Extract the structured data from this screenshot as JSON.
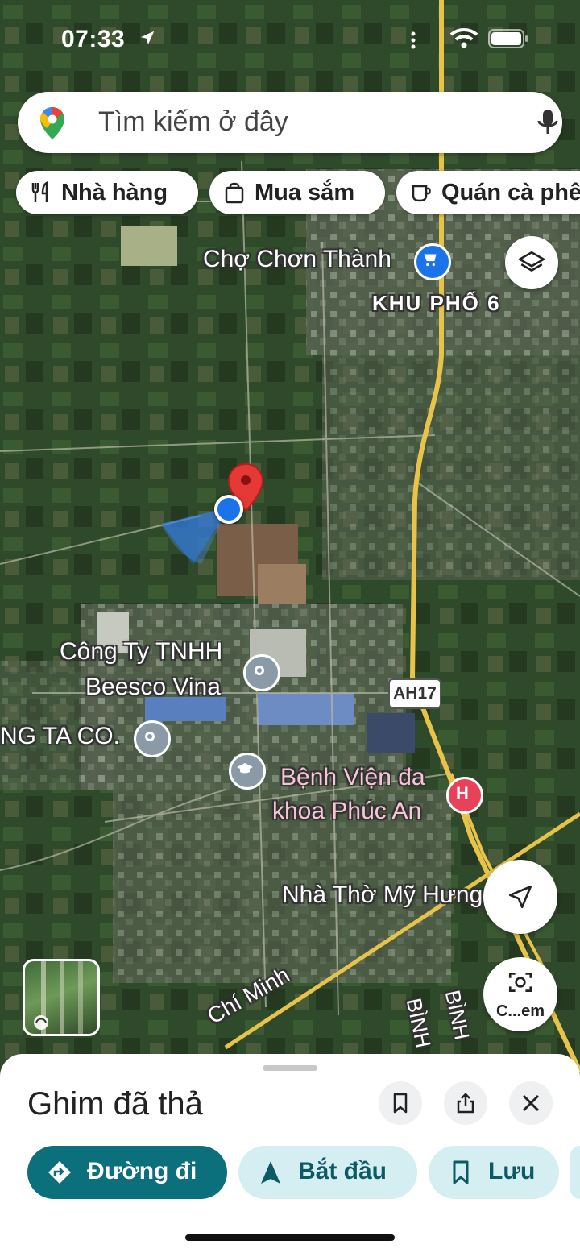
{
  "status_bar": {
    "time": "07:33"
  },
  "search": {
    "placeholder": "Tìm kiếm ở đây"
  },
  "chips": [
    {
      "label": "Nhà hàng",
      "icon": "fork-knife-icon"
    },
    {
      "label": "Mua sắm",
      "icon": "shopping-bag-icon"
    },
    {
      "label": "Quán cà phê",
      "icon": "coffee-cup-icon"
    }
  ],
  "map": {
    "labels": {
      "market": "Chợ Chơn Thành",
      "area": "KHU PHỐ 6",
      "company_line1": "Công Ty TNHH",
      "company_line2": "Beesco Vina",
      "company2": "NG TA CO.",
      "hospital_line1": "Bệnh Viện đa",
      "hospital_line2": "khoa Phúc An",
      "church": "Nhà Thờ Mỹ Hưng",
      "road_name": "Chí Minh",
      "road_binh_1": "BÌNH",
      "road_binh_2": "BÌNH",
      "road_shield": "AH17"
    },
    "colors": {
      "pin": "#e53935",
      "user_location": "#1a73e8",
      "highway": "#e8c34a",
      "hospital": "#e8415a"
    }
  },
  "controls": {
    "lens_label": "C...em"
  },
  "sheet": {
    "title": "Ghim đã thả",
    "actions": {
      "directions": "Đường đi",
      "start": "Bắt đầu",
      "save": "Lưu"
    }
  }
}
